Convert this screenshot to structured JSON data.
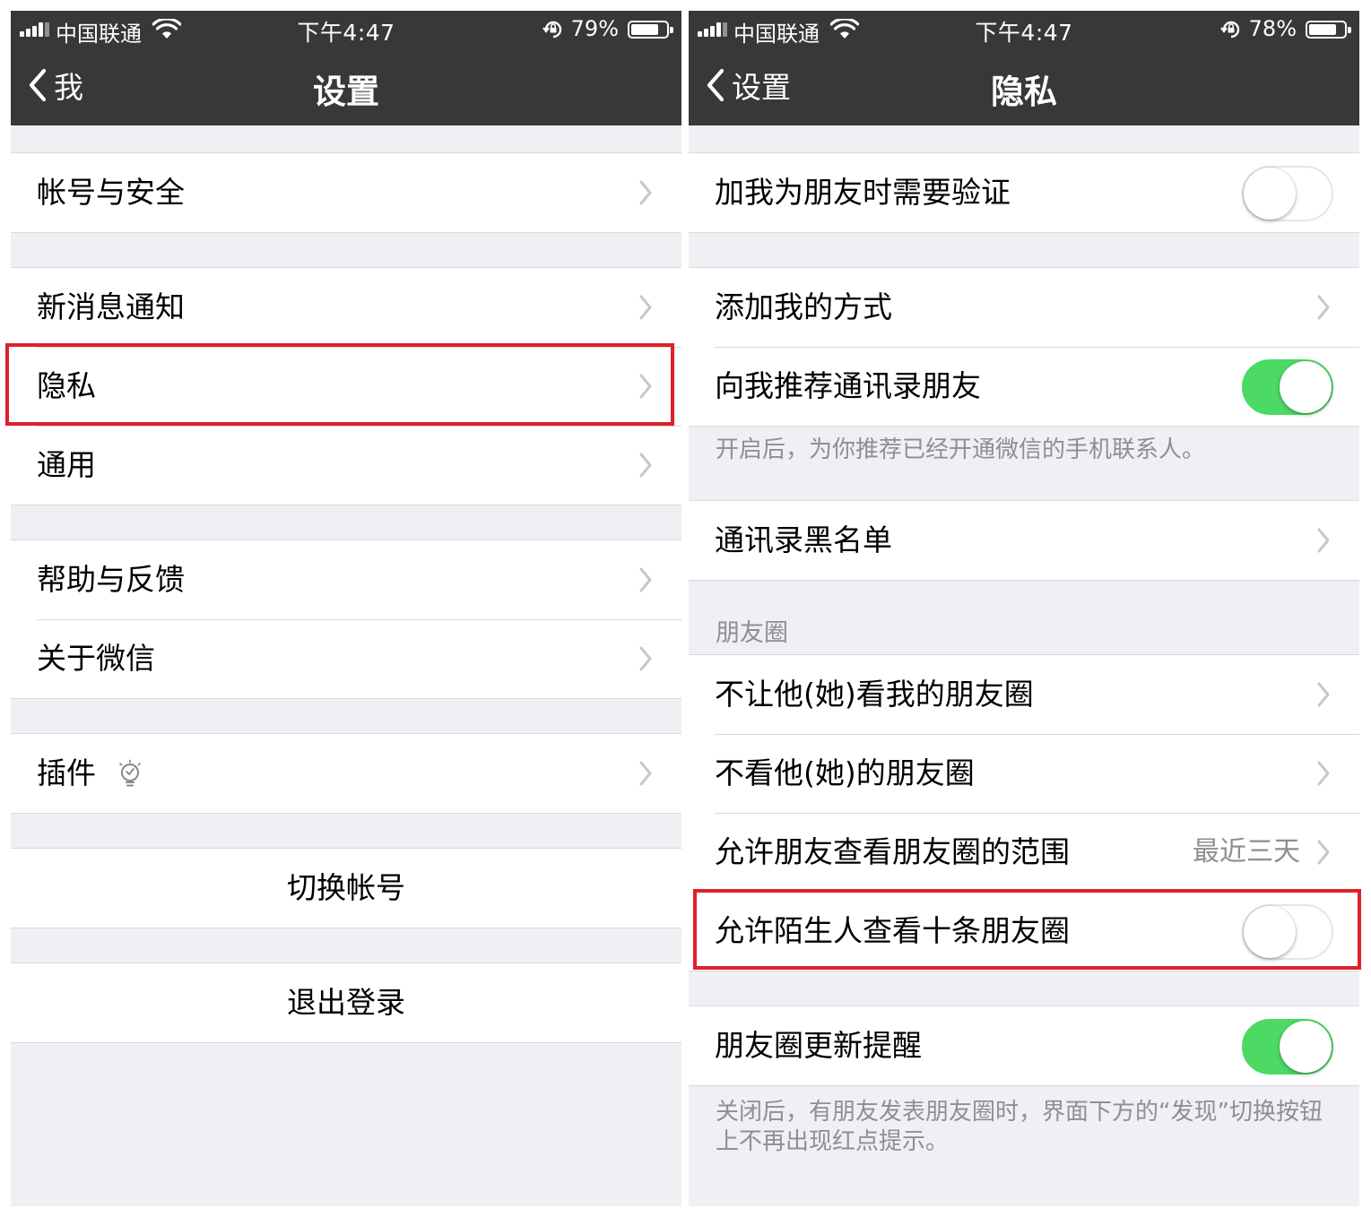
{
  "colors": {
    "navbar_bg": "#38383a",
    "page_bg": "#efeff4",
    "switch_on": "#4cd964",
    "highlight_border": "#e0202a",
    "secondary_text": "#8e8e93"
  },
  "left": {
    "status": {
      "carrier": "中国联通",
      "time": "下午4:47",
      "battery": "79%",
      "battery_level": 0.79
    },
    "nav": {
      "back_label": "我",
      "title": "设置"
    },
    "items": {
      "account_security": "帐号与安全",
      "new_message_notification": "新消息通知",
      "privacy": "隐私",
      "general": "通用",
      "help_feedback": "帮助与反馈",
      "about_wechat": "关于微信",
      "plugins": "插件",
      "switch_account": "切换帐号",
      "logout": "退出登录"
    },
    "icons": {
      "plugins": "lightbulb-icon",
      "disclosure": "chevron-right-icon"
    }
  },
  "right": {
    "status": {
      "carrier": "中国联通",
      "time": "下午4:47",
      "battery": "78%",
      "battery_level": 0.78
    },
    "nav": {
      "back_label": "设置",
      "title": "隐私"
    },
    "items": {
      "verify_friend_requests": {
        "label": "加我为朋友时需要验证",
        "on": false
      },
      "ways_to_add_me": {
        "label": "添加我的方式"
      },
      "recommend_contacts": {
        "label": "向我推荐通讯录朋友",
        "on": true
      },
      "recommend_contacts_note": "开启后，为你推荐已经开通微信的手机联系人。",
      "contacts_blocklist": {
        "label": "通讯录黑名单"
      },
      "moments_header": "朋友圈",
      "hide_my_moments": {
        "label": "不让他(她)看我的朋友圈"
      },
      "hide_their_moments": {
        "label": "不看他(她)的朋友圈"
      },
      "moments_visibility_range": {
        "label": "允许朋友查看朋友圈的范围",
        "value": "最近三天"
      },
      "strangers_view_ten_posts": {
        "label": "允许陌生人查看十条朋友圈",
        "on": false
      },
      "moments_update_reminder": {
        "label": "朋友圈更新提醒",
        "on": true
      },
      "moments_update_note": "关闭后，有朋友发表朋友圈时，界面下方的“发现”切换按钮上不再出现红点提示。"
    }
  }
}
